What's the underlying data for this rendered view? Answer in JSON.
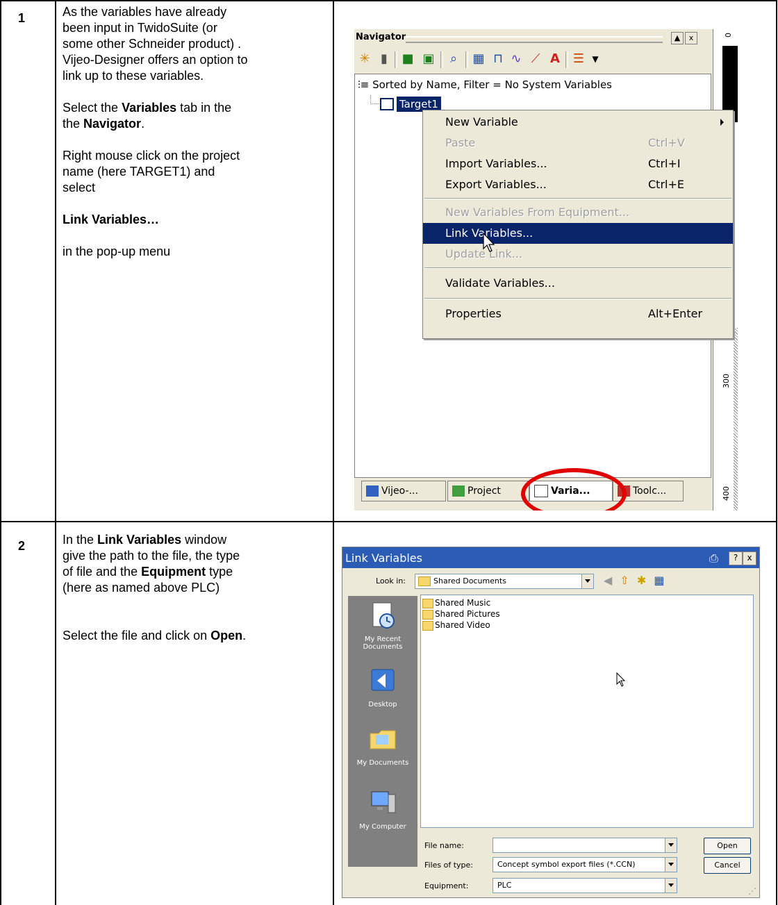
{
  "steps": [
    {
      "number": "1",
      "paragraphs": [
        [
          "As the variables have already been input in TwidoSuite (or some other Schneider product) . Vijeo-Designer offers an option to link up to these variables."
        ],
        [
          "Select the ",
          "Variables",
          " tab in the the ",
          "Navigator",
          "."
        ],
        [
          "Right mouse click on the project name (here TARGET1) and select"
        ],
        [
          "Link Variables…"
        ],
        [
          "in the pop-up menu"
        ]
      ]
    },
    {
      "number": "2",
      "paragraphs": [
        [
          "In the ",
          "Link Variables",
          " window give the path to the file, the type of file and the ",
          "Equipment",
          " type (here as named above PLC)"
        ],
        [
          "Select the file and click on ",
          "Open",
          "."
        ]
      ]
    }
  ],
  "navigator": {
    "title": "Navigator",
    "window_buttons": [
      "▲",
      "x"
    ],
    "tree_header": "Sorted by Name, Filter = No System Variables",
    "tree_node": "Target1",
    "ruler_labels": [
      "0",
      "300",
      "400"
    ],
    "context_menu": [
      {
        "label": "New Variable",
        "shortcut": "",
        "disabled": false,
        "submenu": true
      },
      {
        "label": "Paste",
        "shortcut": "Ctrl+V",
        "disabled": true
      },
      {
        "label": "Import Variables...",
        "shortcut": "Ctrl+I",
        "disabled": false
      },
      {
        "label": "Export Variables...",
        "shortcut": "Ctrl+E",
        "disabled": false
      },
      {
        "label": "New Variables From Equipment...",
        "shortcut": "",
        "disabled": true
      },
      {
        "label": "Link Variables...",
        "shortcut": "",
        "disabled": false,
        "highlighted": true
      },
      {
        "label": "Update Link...",
        "shortcut": "",
        "disabled": true
      },
      {
        "label": "Validate Variables...",
        "shortcut": "",
        "disabled": false
      },
      {
        "label": "Properties",
        "shortcut": "Alt+Enter",
        "disabled": false
      }
    ],
    "tabs": [
      {
        "label": "Vijeo-...",
        "active": false
      },
      {
        "label": "Project",
        "active": false
      },
      {
        "label": "Varia...",
        "active": true
      },
      {
        "label": "Toolc...",
        "active": false
      }
    ]
  },
  "link_dialog": {
    "title": "Link Variables",
    "title_buttons": [
      "?",
      "x"
    ],
    "look_in_label": "Look in:",
    "look_in_value": "Shared Documents",
    "places": [
      "My Recent Documents",
      "Desktop",
      "My Documents",
      "My Computer"
    ],
    "files": [
      "Shared Music",
      "Shared Pictures",
      "Shared Video"
    ],
    "file_name_label": "File name:",
    "file_name_value": "",
    "files_of_type_label": "Files of type:",
    "files_of_type_value": "Concept symbol export files (*.CCN)",
    "equipment_label": "Equipment:",
    "equipment_value": "PLC",
    "open_label": "Open",
    "cancel_label": "Cancel"
  },
  "colors": {
    "highlight": "#0a246a",
    "annotation_circle": "#e00000",
    "dialog_title": "#2a5bb5"
  }
}
